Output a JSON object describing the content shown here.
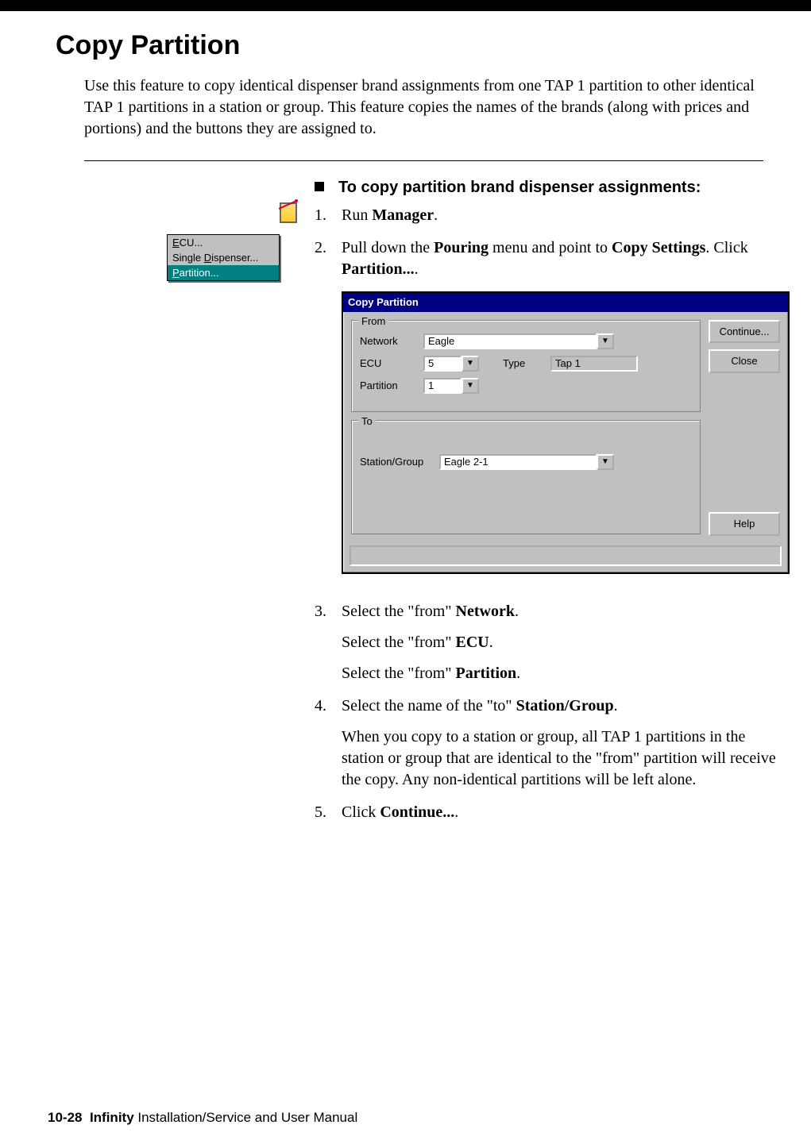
{
  "title": "Copy Partition",
  "intro": "Use this feature to copy identical dispenser brand assignments from one TAP 1 partition to other identical TAP 1 partitions in a station or group. This feature copies the names of the brands (along with prices and portions) and the buttons they are assigned to.",
  "task_heading": "To copy partition brand dispenser assignments:",
  "submenu": {
    "item1_pre": "E",
    "item1_rest": "CU...",
    "item2_pre": "Single ",
    "item2_u": "D",
    "item2_rest": "ispenser...",
    "item3_u": "P",
    "item3_rest": "artition..."
  },
  "steps": {
    "s1_num": "1.",
    "s1_a": "Run ",
    "s1_b": "Manager",
    "s1_c": ".",
    "s2_num": "2.",
    "s2_a": "Pull down the ",
    "s2_b": "Pouring",
    "s2_c": " menu and point to ",
    "s2_d": "Copy Settings",
    "s2_e": ". Click ",
    "s2_f": "Partition...",
    "s2_g": ".",
    "s3_num": "3.",
    "s3_a": "Select the \"from\" ",
    "s3_b": "Network",
    "s3_c": ".",
    "s3_d": "Select the \"from\" ",
    "s3_e": "ECU",
    "s3_f": ".",
    "s3_g": "Select the \"from\" ",
    "s3_h": "Partition",
    "s3_i": ".",
    "s4_num": "4.",
    "s4_a": "Select the name of the \"to\" ",
    "s4_b": "Station/Group",
    "s4_c": ".",
    "s4_d": "When you copy to a station or group, all TAP 1 partitions in the station or group that are identical to the \"from\" partition will receive the copy. Any non-identical partitions will be left alone.",
    "s5_num": "5.",
    "s5_a": "Click ",
    "s5_b": "Continue...",
    "s5_c": "."
  },
  "dialog": {
    "title": "Copy Partition",
    "from_legend": "From",
    "to_legend": "To",
    "lbl_network": "Network",
    "lbl_ecu": "ECU",
    "lbl_type": "Type",
    "lbl_partition": "Partition",
    "lbl_station": "Station/Group",
    "val_network": "Eagle",
    "val_ecu": "5",
    "val_type": "Tap 1",
    "val_partition": "1",
    "val_station": "Eagle 2-1",
    "btn_continue": "Continue...",
    "btn_close": "Close",
    "btn_help": "Help"
  },
  "footer": {
    "pagenum": "10-28",
    "product": "Infinity",
    "rest": " Installation/Service and User Manual"
  }
}
